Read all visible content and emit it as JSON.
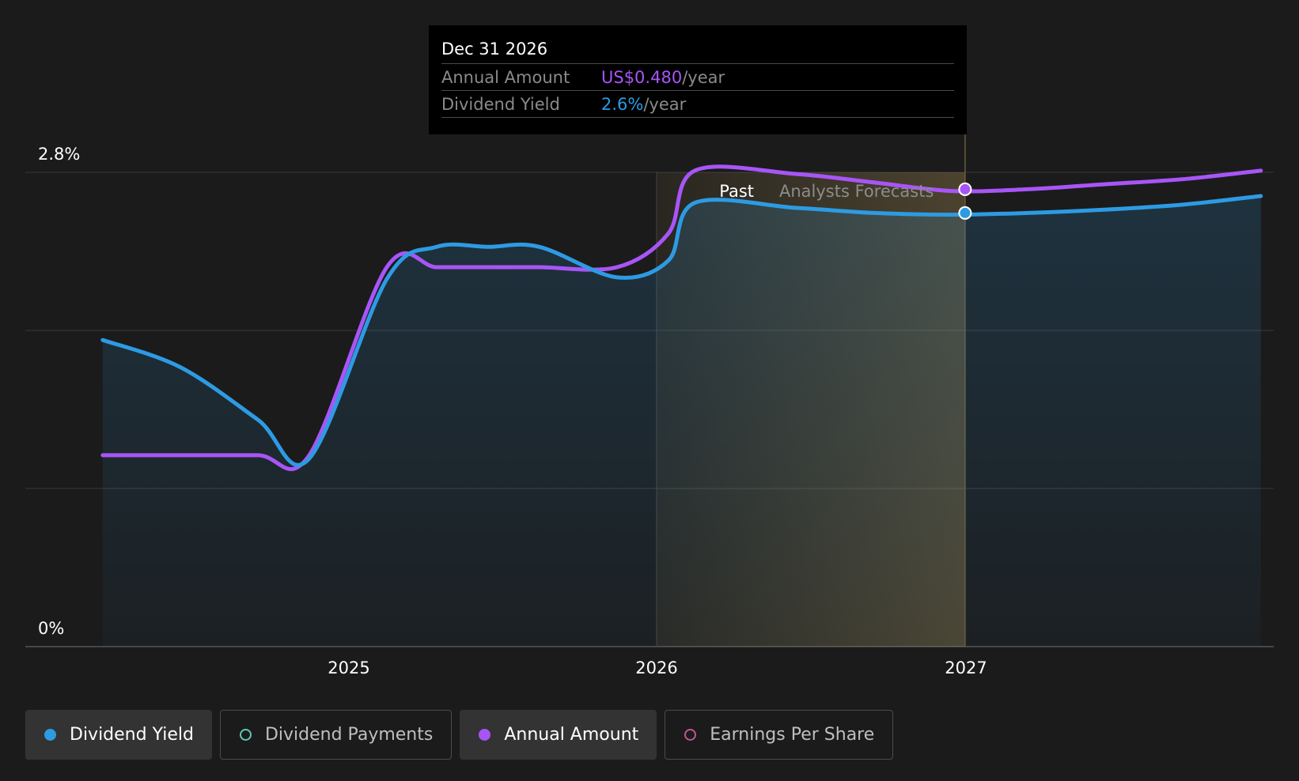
{
  "chart_data": {
    "type": "line",
    "title": "",
    "x": [
      "2024-03",
      "2024-06",
      "2024-09",
      "2024-11",
      "2025-02",
      "2025-04",
      "2025-06",
      "2025-08",
      "2025-11",
      "2026-01",
      "2026-02",
      "2026-06",
      "2026-09",
      "2026-12",
      "2027-03",
      "2027-06",
      "2027-09",
      "2027-12"
    ],
    "series": [
      {
        "name": "Dividend Yield",
        "color": "#2d9be3",
        "values": [
          1.81,
          1.65,
          1.34,
          1.11,
          2.17,
          2.36,
          2.36,
          2.36,
          2.18,
          2.28,
          2.62,
          2.59,
          2.56,
          2.55,
          2.56,
          2.58,
          2.61,
          2.66
        ]
      },
      {
        "name": "Annual Amount",
        "color": "#a855f7",
        "values": [
          1.13,
          1.13,
          1.13,
          1.13,
          2.24,
          2.24,
          2.24,
          2.24,
          2.24,
          2.44,
          2.81,
          2.79,
          2.74,
          2.69,
          2.7,
          2.73,
          2.76,
          2.81
        ]
      }
    ],
    "xticks": [
      "2025",
      "2026",
      "2027"
    ],
    "yticks": [
      "0%",
      "2.8%"
    ],
    "ylim": [
      0,
      2.8
    ],
    "grid": true,
    "regions": {
      "past": "Past",
      "forecast": "Analysts Forecasts"
    },
    "tooltip_marker_x": "2026-12-31"
  },
  "tooltip": {
    "date": "Dec 31 2026",
    "rows": [
      {
        "label": "Annual Amount",
        "value": "US$0.480",
        "unit": "/year"
      },
      {
        "label": "Dividend Yield",
        "value": "2.6%",
        "unit": "/year"
      }
    ]
  },
  "legend": [
    {
      "label": "Dividend Yield",
      "color": "#2d9be3",
      "active": true,
      "filled": true
    },
    {
      "label": "Dividend Payments",
      "color": "#5ec8b9",
      "active": false,
      "filled": false
    },
    {
      "label": "Annual Amount",
      "color": "#a855f7",
      "active": true,
      "filled": true
    },
    {
      "label": "Earnings Per Share",
      "color": "#c2568f",
      "active": false,
      "filled": false
    }
  ]
}
